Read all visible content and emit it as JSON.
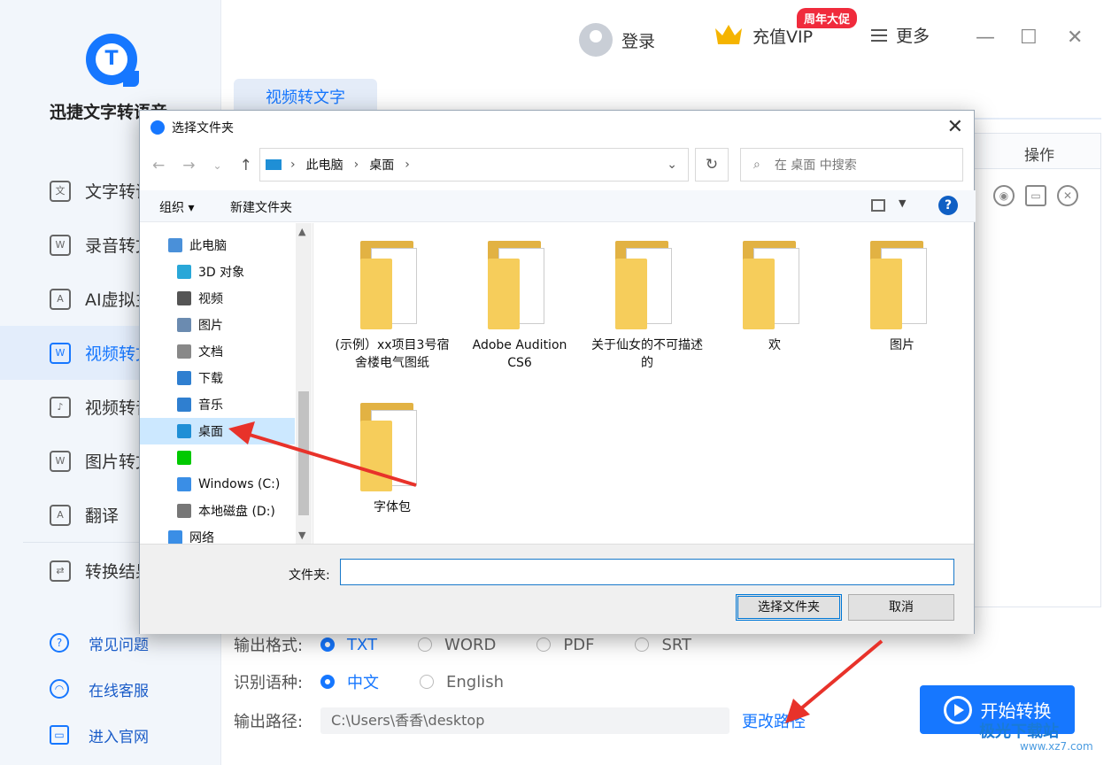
{
  "app": {
    "logo_letter": "T",
    "name": "迅捷文字转语音"
  },
  "sidebar": {
    "items": [
      {
        "label": "文字转语音",
        "icon": "text-to-speech-icon"
      },
      {
        "label": "录音转文字",
        "icon": "recording-to-text-icon"
      },
      {
        "label": "AI虚拟主播",
        "icon": "ai-avatar-icon"
      },
      {
        "label": "视频转文字",
        "icon": "video-to-text-icon",
        "active": true
      },
      {
        "label": "视频转音频",
        "icon": "video-to-audio-icon"
      },
      {
        "label": "图片转文字",
        "icon": "image-to-text-icon"
      },
      {
        "label": "翻译",
        "icon": "translate-icon"
      },
      {
        "label": "转换结果",
        "icon": "results-icon"
      }
    ],
    "links": [
      {
        "label": "常见问题",
        "icon": "help-icon"
      },
      {
        "label": "在线客服",
        "icon": "headset-icon"
      },
      {
        "label": "进入官网",
        "icon": "monitor-icon"
      }
    ]
  },
  "header": {
    "login": "登录",
    "vip": "充值VIP",
    "promo": "周年大促",
    "more": "更多"
  },
  "main": {
    "tab": "视频转文字",
    "table_op_header": "操作"
  },
  "options": {
    "format_label": "输出格式:",
    "formats": [
      "TXT",
      "WORD",
      "PDF",
      "SRT"
    ],
    "selected_format": "TXT",
    "lang_label": "识别语种:",
    "languages": [
      "中文",
      "English"
    ],
    "selected_language": "中文",
    "path_label": "输出路径:",
    "path_value": "C:\\Users\\香香\\desktop",
    "change_path": "更改路径",
    "start": "开始转换"
  },
  "watermark": {
    "line1": "极光下载站",
    "line2": "www.xz7.com"
  },
  "dialog": {
    "title": "选择文件夹",
    "breadcrumb": [
      "此电脑",
      "桌面"
    ],
    "search_placeholder": "在 桌面 中搜索",
    "toolbar": {
      "organize": "组织 ▾",
      "new_folder": "新建文件夹"
    },
    "tree": [
      {
        "label": "此电脑",
        "icon": "computer-icon",
        "color": "#4a90d9"
      },
      {
        "label": "3D 对象",
        "icon": "3d-objects-icon",
        "color": "#29a7d8"
      },
      {
        "label": "视频",
        "icon": "video-folder-icon",
        "color": "#555555"
      },
      {
        "label": "图片",
        "icon": "pictures-folder-icon",
        "color": "#6b8bb0"
      },
      {
        "label": "文档",
        "icon": "documents-folder-icon",
        "color": "#888888"
      },
      {
        "label": "下载",
        "icon": "downloads-folder-icon",
        "color": "#2f7fd0"
      },
      {
        "label": "音乐",
        "icon": "music-folder-icon",
        "color": "#2f7fd0"
      },
      {
        "label": "桌面",
        "icon": "desktop-folder-icon",
        "color": "#1f8fd6",
        "selected": true
      },
      {
        "label": "",
        "icon": "iqiyi-icon",
        "color": "#00c900"
      },
      {
        "label": "Windows (C:)",
        "icon": "windows-drive-icon",
        "color": "#3a8ee6"
      },
      {
        "label": "本地磁盘 (D:)",
        "icon": "local-disk-icon",
        "color": "#777777"
      },
      {
        "label": "网络",
        "icon": "network-icon",
        "color": "#3a8ee6"
      }
    ],
    "files": [
      {
        "name": "(示例）xx项目3号宿舍楼电气图纸"
      },
      {
        "name": "Adobe Audition CS6"
      },
      {
        "name": "关于仙女的不可描述的"
      },
      {
        "name": "欢"
      },
      {
        "name": "图片"
      },
      {
        "name": "字体包"
      }
    ],
    "folder_label": "文件夹:",
    "folder_value": "",
    "select_button": "选择文件夹",
    "cancel_button": "取消"
  },
  "colors": {
    "accent": "#1677ff",
    "promo": "#f02b3c",
    "arrow": "#e8322a"
  }
}
